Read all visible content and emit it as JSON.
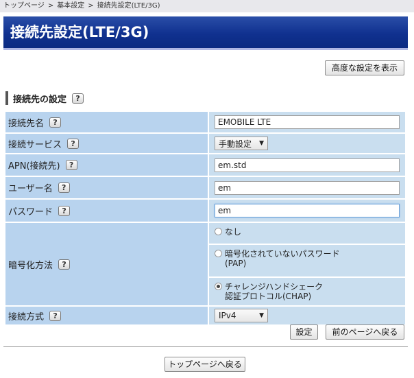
{
  "breadcrumb": [
    "トップページ",
    "基本設定",
    "接続先設定(LTE/3G)"
  ],
  "breadcrumb_sep": ">",
  "page_title": "接続先設定(LTE/3G)",
  "advanced_button": "高度な設定を表示",
  "section_title": "接続先の設定",
  "help_label": "?",
  "fields": {
    "profile_name": {
      "label": "接続先名",
      "value": "EMOBILE LTE"
    },
    "service": {
      "label": "接続サービス",
      "value": "手動設定"
    },
    "apn": {
      "label": "APN(接続先)",
      "value": "em.std"
    },
    "username": {
      "label": "ユーザー名",
      "value": "em"
    },
    "password": {
      "label": "パスワード",
      "value": "em"
    },
    "auth": {
      "label": "暗号化方法",
      "options": [
        {
          "line1": "なし",
          "line2": "",
          "selected": false
        },
        {
          "line1": "暗号化されていないパスワード",
          "line2": "(PAP)",
          "selected": false
        },
        {
          "line1": "チャレンジハンドシェーク",
          "line2": "認証プロトコル(CHAP)",
          "selected": true
        }
      ]
    },
    "ip_type": {
      "label": "接続方式",
      "value": "IPv4"
    }
  },
  "buttons": {
    "apply": "設定",
    "back": "前のページへ戻る",
    "top": "トップページへ戻る"
  },
  "colors": {
    "banner": "#10318f",
    "label_bg": "#b8d3ee",
    "value_bg": "#c9deef"
  }
}
